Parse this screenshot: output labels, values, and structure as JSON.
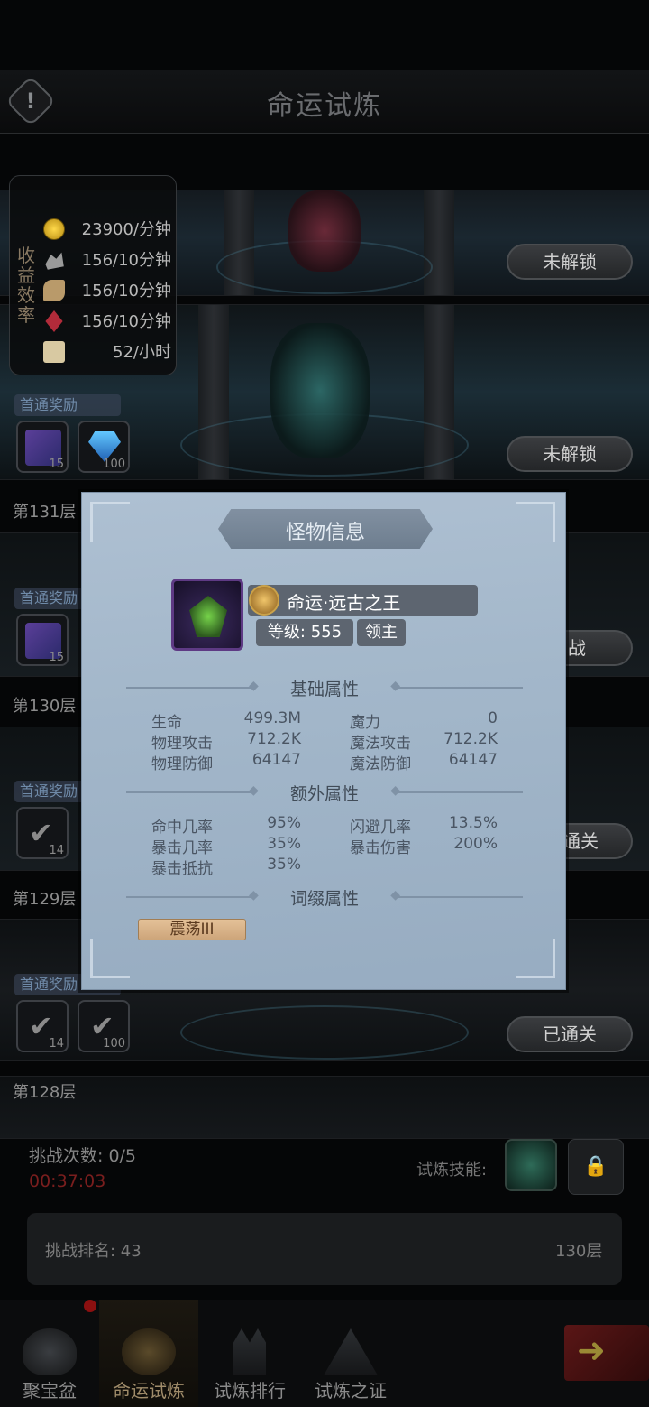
{
  "header": {
    "title": "命运试炼"
  },
  "income": {
    "vertical_label": "收益效率",
    "rows": [
      {
        "icon": "gold-coin-icon",
        "value": "23900/分钟"
      },
      {
        "icon": "ore-icon",
        "value": "156/10分钟"
      },
      {
        "icon": "wood-icon",
        "value": "156/10分钟"
      },
      {
        "icon": "red-gem-icon",
        "value": "156/10分钟"
      },
      {
        "icon": "scroll-icon",
        "value": "52/小时"
      }
    ]
  },
  "stages": [
    {
      "button": "未解锁"
    },
    {
      "button": "未解锁"
    },
    {
      "floor": "第131层",
      "reward_label": "首通奖励",
      "items": [
        "15"
      ],
      "button": "战"
    },
    {
      "floor": "第130层",
      "reward_label": "首通奖励",
      "items": [
        "14"
      ],
      "button": "通关"
    },
    {
      "floor": "第129层",
      "reward_label": "首通奖励",
      "items": [
        "14",
        "100"
      ],
      "button": "已通关"
    },
    {
      "floor": "第128层"
    }
  ],
  "top_rewards": {
    "label": "首通奖励",
    "items": [
      "15",
      "100"
    ]
  },
  "bottom": {
    "challenge_count": "挑战次数: 0/5",
    "timer": "00:37:03",
    "skill_label": "试炼技能:",
    "rank_label": "挑战排名: 43",
    "rank_floor": "130层"
  },
  "nav": {
    "items": [
      {
        "label": "聚宝盆",
        "icon": "treasure-bowl-icon"
      },
      {
        "label": "命运试炼",
        "icon": "fate-trial-icon"
      },
      {
        "label": "试炼排行",
        "icon": "ranking-icon"
      },
      {
        "label": "试炼之证",
        "icon": "trial-proof-icon"
      }
    ]
  },
  "modal": {
    "title": "怪物信息",
    "monster_name": "命运·远古之王",
    "level": "等级: 555",
    "badge": "领主",
    "sections": {
      "basic": "基础属性",
      "extra": "额外属性",
      "affix": "词缀属性"
    },
    "basic_stats": [
      {
        "label": "生命",
        "value": "499.3M"
      },
      {
        "label": "魔力",
        "value": "0"
      },
      {
        "label": "物理攻击",
        "value": "712.2K"
      },
      {
        "label": "魔法攻击",
        "value": "712.2K"
      },
      {
        "label": "物理防御",
        "value": "64147"
      },
      {
        "label": "魔法防御",
        "value": "64147"
      }
    ],
    "extra_stats": [
      {
        "label": "命中几率",
        "value": "95%"
      },
      {
        "label": "闪避几率",
        "value": "13.5%"
      },
      {
        "label": "暴击几率",
        "value": "35%"
      },
      {
        "label": "暴击伤害",
        "value": "200%"
      },
      {
        "label": "暴击抵抗",
        "value": "35%"
      }
    ],
    "affixes": [
      "震荡III"
    ]
  },
  "colors": {
    "modal_bg": "#a3b7ca",
    "affix_tag": "#d9b48b",
    "timer_red": "#7a1e1e",
    "nav_active": "#a08c6a"
  }
}
